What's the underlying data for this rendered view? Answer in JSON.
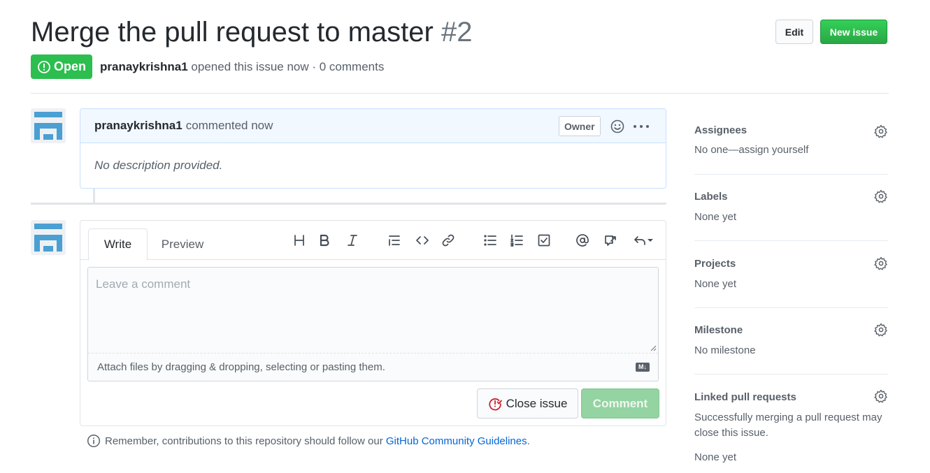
{
  "issue": {
    "title": "Merge the pull request to master",
    "number": "#2",
    "state": "Open",
    "author": "pranaykrishna1",
    "opened_text": "opened this issue now · 0 comments"
  },
  "header_buttons": {
    "edit": "Edit",
    "new_issue": "New issue"
  },
  "comment": {
    "author": "pranaykrishna1",
    "action": "commented now",
    "badge": "Owner",
    "body": "No description provided."
  },
  "editor": {
    "tab_write": "Write",
    "tab_preview": "Preview",
    "placeholder": "Leave a comment",
    "attach_text": "Attach files by dragging & dropping, selecting or pasting them.",
    "markdown_badge": "M↓",
    "close_button": "Close issue",
    "comment_button": "Comment",
    "toolbar_icons": [
      "header-icon",
      "bold-icon",
      "italic-icon",
      "quote-icon",
      "code-icon",
      "link-icon",
      "unordered-list-icon",
      "ordered-list-icon",
      "task-list-icon",
      "mention-icon",
      "reference-icon",
      "reply-icon"
    ]
  },
  "guideline": {
    "prefix": "Remember, contributions to this repository should follow our",
    "link": "GitHub Community Guidelines",
    "suffix": "."
  },
  "sidebar": {
    "assignees": {
      "title": "Assignees",
      "value": "No one—assign yourself"
    },
    "labels": {
      "title": "Labels",
      "value": "None yet"
    },
    "projects": {
      "title": "Projects",
      "value": "None yet"
    },
    "milestone": {
      "title": "Milestone",
      "value": "No milestone"
    },
    "linked": {
      "title": "Linked pull requests",
      "description": "Successfully merging a pull request may close this issue.",
      "value": "None yet"
    }
  },
  "colors": {
    "open_green": "#2cbe4e",
    "new_issue_green": "#28a745",
    "comment_header_bg": "#f1f8ff",
    "link_blue": "#0366d6",
    "close_icon_red": "#cb2431"
  }
}
